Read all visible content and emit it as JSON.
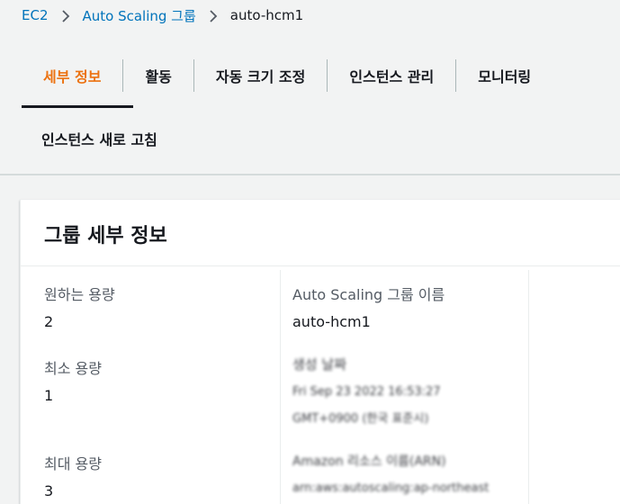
{
  "breadcrumb": {
    "items": [
      "EC2",
      "Auto Scaling 그룹"
    ],
    "current": "auto-hcm1"
  },
  "tabs": {
    "row1": [
      "세부 정보",
      "활동",
      "자동 크기 조정",
      "인스턴스 관리",
      "모니터링"
    ],
    "row2": "인스턴스 새로 고침",
    "active": "세부 정보"
  },
  "panel": {
    "title": "그룹 세부 정보",
    "col1": {
      "desired_label": "원하는 용량",
      "desired_value": "2",
      "min_label": "최소 용량",
      "min_value": "1",
      "max_label": "최대 용량",
      "max_value": "3"
    },
    "col2": {
      "name_label": "Auto Scaling 그룹 이름",
      "name_value": "auto-hcm1",
      "created_label": "생성 날짜",
      "created_value_1": "Fri Sep 23 2022 16:53:27",
      "created_value_2": "GMT+0900 (한국 표준시)",
      "arn_label": "Amazon 리소스 이름(ARN)",
      "arn_value": "arn:aws:autoscaling:ap-northeast"
    }
  },
  "colors": {
    "accent": "#ec7211",
    "link": "#0073bb",
    "background": "#f2f3f3"
  }
}
